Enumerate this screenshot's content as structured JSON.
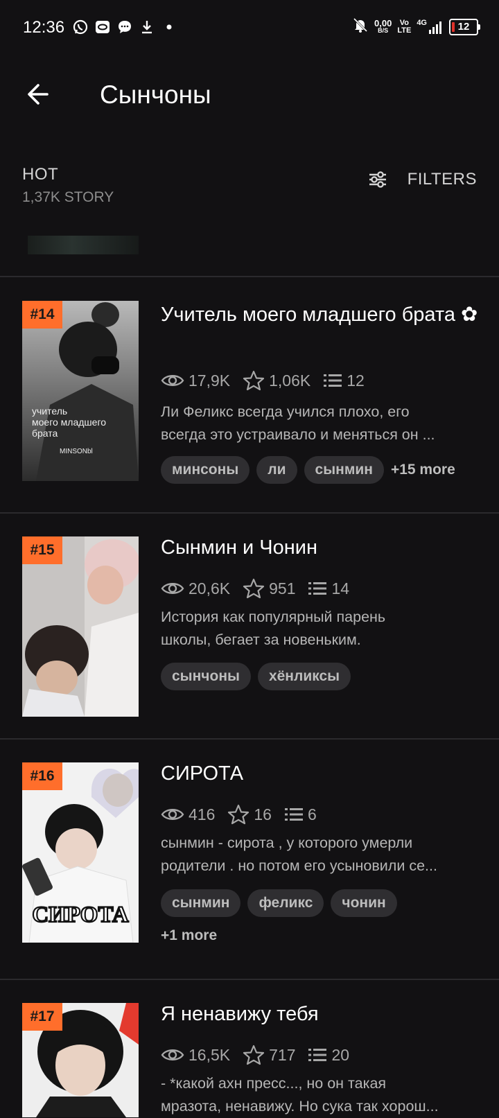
{
  "status_bar": {
    "time": "12:36",
    "net_speed": "0,00",
    "net_unit": "B/S",
    "volte_top": "Vo",
    "volte_bottom": "LTE",
    "network": "4G",
    "battery": "12",
    "battery_color": "#e0312a"
  },
  "header": {
    "title": "Сынчоны"
  },
  "sort": {
    "label": "HOT",
    "count": "1,37K STORY",
    "filters_label": "FILTERS"
  },
  "accent_color": "#ff6e2b",
  "stories": [
    {
      "rank": "#14",
      "title": "Учитель моего младшего брата ✿",
      "views": "17,9K",
      "votes": "1,06K",
      "parts": "12",
      "desc_lines": [
        "Ли Феликс всегда учился плохо, его",
        "всегда это устраивало и меняться он ..."
      ],
      "tags": [
        "минсоны",
        "ли",
        "сынмин"
      ],
      "more": "+15 more",
      "cover_text": [
        "учитель",
        "моего младшего",
        "брата"
      ],
      "cover_sign": "MINSONbl"
    },
    {
      "rank": "#15",
      "title": "Сынмин и Чонин",
      "views": "20,6K",
      "votes": "951",
      "parts": "14",
      "desc_lines": [
        "История как популярный парень",
        "школы, бегает за новеньким."
      ],
      "tags": [
        "сынчоны",
        "хёнликсы"
      ],
      "more": ""
    },
    {
      "rank": "#16",
      "title": "СИРОТА",
      "views": "416",
      "votes": "16",
      "parts": "6",
      "desc_lines": [
        "сынмин - сирота , у которого умерли",
        "родители . но потом его усыновили се..."
      ],
      "tags": [
        "сынмин",
        "феликс",
        "чонин"
      ],
      "more": "+1 more",
      "cover_text": "СИРОТА"
    },
    {
      "rank": "#17",
      "title": "Я ненавижу тебя",
      "views": "16,5K",
      "votes": "717",
      "parts": "20",
      "desc_lines": [
        "- *какой ахн пресс..., но он такая",
        "мразота, ненавижу. Но сука так хорош..."
      ],
      "tags": [],
      "more": ""
    }
  ]
}
